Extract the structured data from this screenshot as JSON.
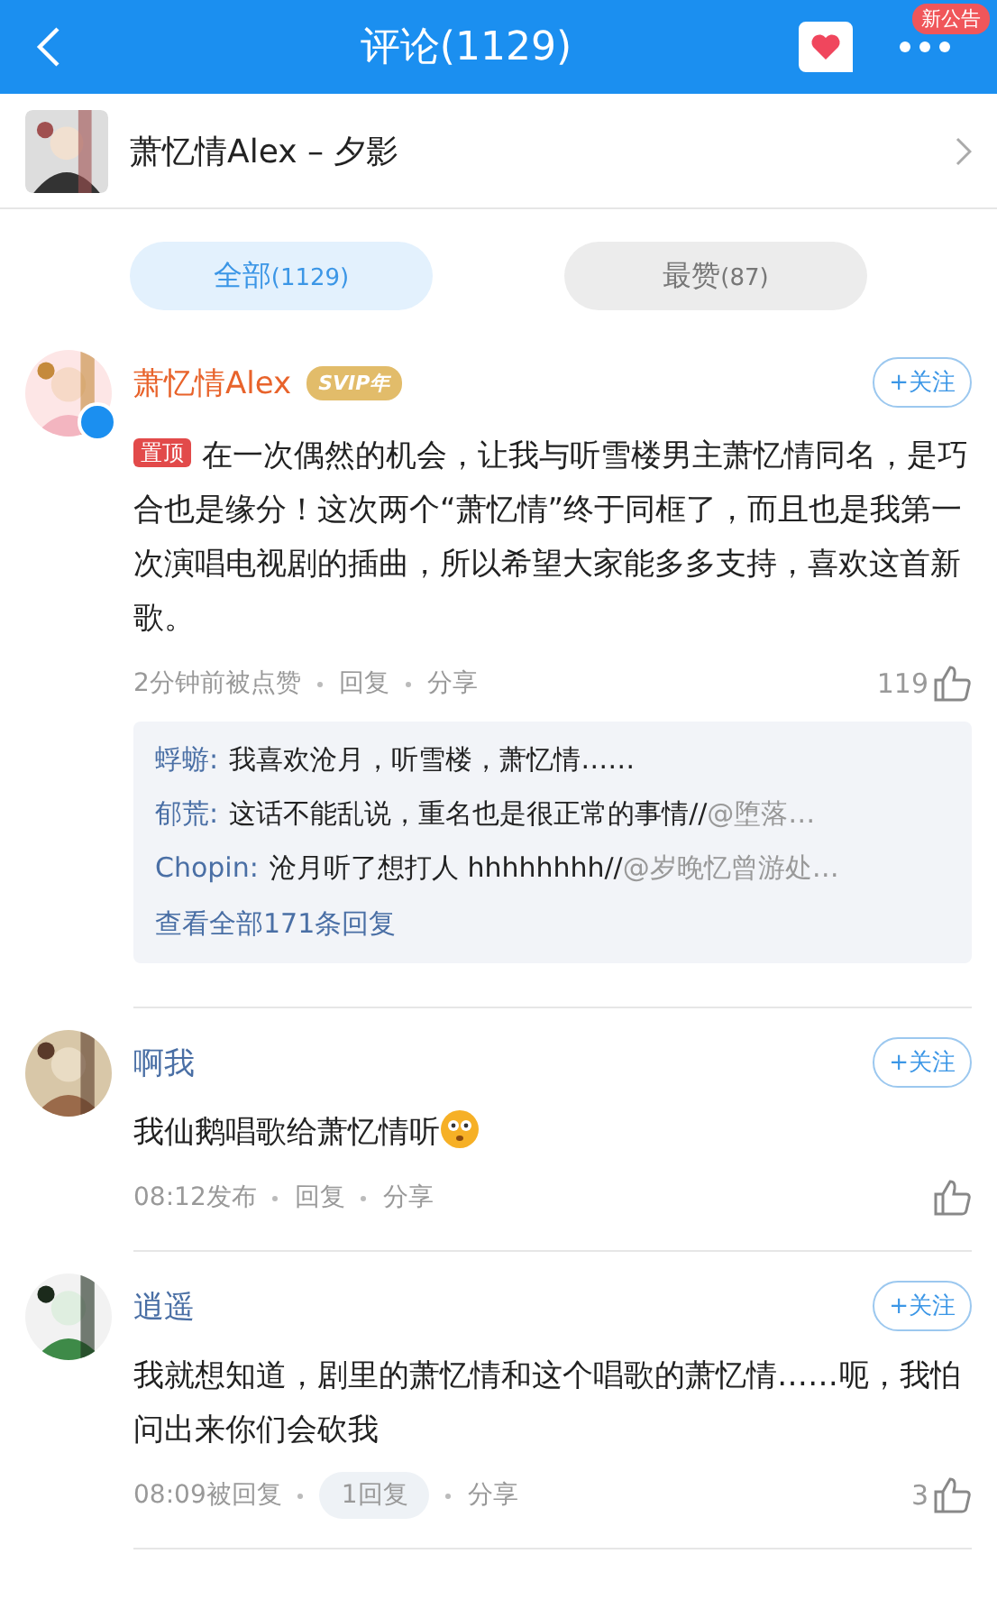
{
  "header": {
    "title": "评论(1129)",
    "notice_badge": "新公告"
  },
  "song": {
    "title": "萧忆情Alex – 夕影"
  },
  "tabs": [
    {
      "label": "全部",
      "count": "(1129)",
      "selected": true
    },
    {
      "label": "最赞",
      "count": "(87)",
      "selected": false
    }
  ],
  "comments": [
    {
      "author": "萧忆情Alex",
      "vip_badge": "SVIP年",
      "follow": "+关注",
      "pinned_label": "置顶",
      "text": "在一次偶然的机会，让我与听雪楼男主萧忆情同名，是巧合也是缘分！这次两个“萧忆情”终于同框了，而且也是我第一次演唱电视剧的插曲，所以希望大家能多多支持，喜欢这首新歌。",
      "emoji": false,
      "time": "2分钟前被点赞",
      "reply": "回复",
      "has_replies": false,
      "share": "分享",
      "likes": "119",
      "replies": [
        {
          "name": "蜉蝣:",
          "text": "我喜欢沧月，听雪楼，萧忆情……"
        },
        {
          "name": "郁荒:",
          "text": "这话不能乱说，重名也是很正常的事情//",
          "quote": "@堕落…"
        },
        {
          "name": "Chopin:",
          "text": "沧月听了想打人 hhhhhhhh//",
          "quote": "@岁晚忆曾游处…"
        }
      ],
      "more_replies": "查看全部171条回复"
    },
    {
      "author": "啊我",
      "follow": "+关注",
      "text": "我仙鹅唱歌给萧忆情听",
      "emoji": true,
      "time": "08:12发布",
      "reply": "回复",
      "has_replies": false,
      "share": "分享"
    },
    {
      "author": "逍遥",
      "follow": "+关注",
      "text": "我就想知道，剧里的萧忆情和这个唱歌的萧忆情……呃，我怕问出来你们会砍我",
      "emoji": false,
      "time": "08:09被回复",
      "reply": "1回复",
      "has_replies": true,
      "share": "分享",
      "likes": "3"
    }
  ]
}
